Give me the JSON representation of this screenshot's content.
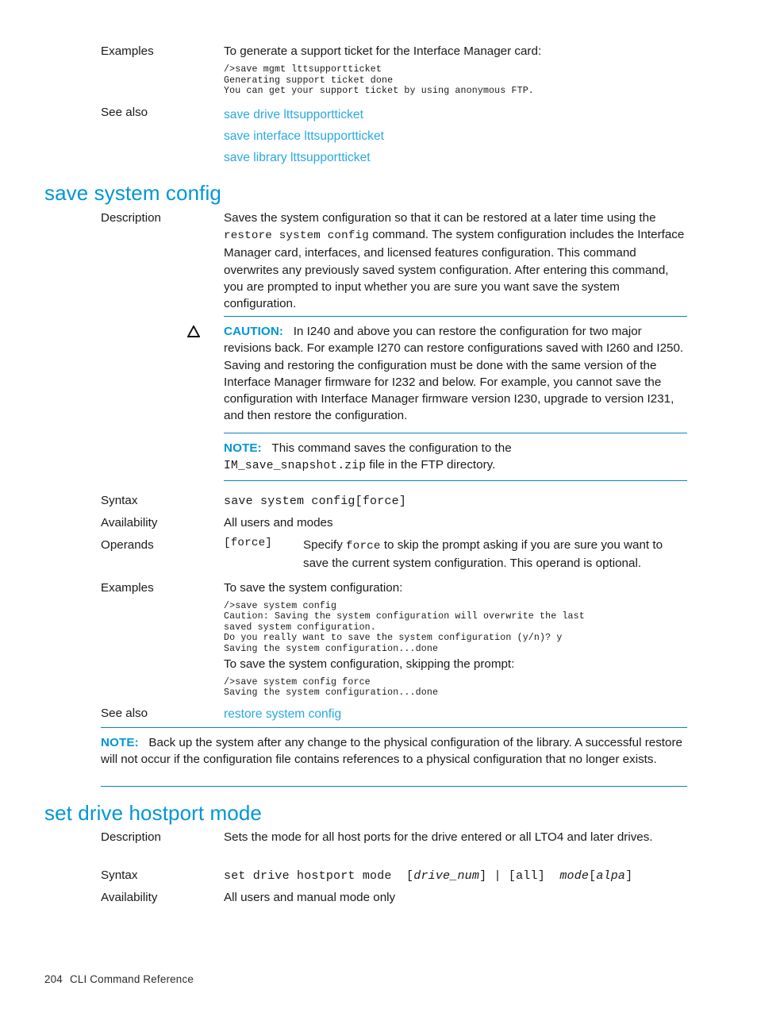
{
  "page": {
    "footer_page_number": "204",
    "footer_title": "CLI Command Reference",
    "accent_color": "#0096d6",
    "link_color": "#2aa8e0",
    "rule_color": "#0a82bd"
  },
  "top_section": {
    "examples_label": "Examples",
    "examples_intro": "To generate a support ticket for the Interface Manager card:",
    "examples_transcript": "/>save mgmt lttsupportticket\nGenerating support ticket done\nYou can get your support ticket by using anonymous FTP.",
    "see_also_label": "See also",
    "see_also_links": [
      "save drive lttsupportticket",
      "save interface lttsupportticket",
      "save library lttsupportticket"
    ]
  },
  "save_system_config": {
    "heading": "save system config",
    "description_label": "Description",
    "description_part1": "Saves the system configuration so that it can be restored at a later time using the ",
    "description_code1": "restore system config",
    "description_part2": " command. The system configuration includes the Interface Manager card, interfaces, and licensed features configuration. This command overwrites any previously saved system configuration. After entering this command, you are prompted to input whether you are sure you want save the system configuration.",
    "caution": {
      "keyword": "CAUTION:",
      "icon": "caution-triangle-icon",
      "text": "In I240 and above you can restore the configuration for two major revisions back. For example I270 can restore configurations saved with I260 and I250. Saving and restoring the configuration must be done with the same version of the Interface Manager firmware for I232 and below. For example, you cannot save the configuration with Interface Manager firmware version I230, upgrade to version I231, and then restore the configuration."
    },
    "note": {
      "keyword": "NOTE:",
      "text_part1": "This command saves the configuration to the ",
      "code": "IM_save_snapshot.zip",
      "text_part2": " file in the FTP directory."
    },
    "syntax_label": "Syntax",
    "syntax_code": "save system config",
    "syntax_operand": "[force]",
    "availability_label": "Availability",
    "availability_value": "All users and modes",
    "operands_label": "Operands",
    "operands_token": "[force]",
    "operands_text_part1": "Specify ",
    "operands_text_code": "force",
    "operands_text_part2": " to skip the prompt asking if you are sure you want to save the current system configuration. This operand is optional.",
    "examples_label": "Examples",
    "example1_intro": "To save the system configuration:",
    "example1_transcript": "/>save system config\nCaution: Saving the system configuration will overwrite the last\nsaved system configuration.\nDo you really want to save the system configuration (y/n)? y\nSaving the system configuration...done",
    "example2_intro": "To save the system configuration, skipping the prompt:",
    "example2_transcript": "/>save system config force\nSaving the system configuration...done",
    "see_also_label": "See also",
    "see_also_link": "restore system config",
    "bottom_note": {
      "keyword": "NOTE:",
      "text": "Back up the system after any change to the physical configuration of the library. A successful restore will not occur if the configuration file contains references to a physical configuration that no longer exists."
    }
  },
  "set_drive_hostport_mode": {
    "heading": "set drive hostport mode",
    "description_label": "Description",
    "description_value": "Sets the mode for all host ports for the drive entered or all LTO4 and later drives.",
    "syntax_label": "Syntax",
    "syntax_tokens": [
      {
        "text": "set drive hostport mode",
        "style": "mono"
      },
      {
        "text": "  ",
        "style": "mono"
      },
      {
        "text": "[",
        "style": "mono"
      },
      {
        "text": "drive_num",
        "style": "mono-i"
      },
      {
        "text": "]",
        "style": "mono"
      },
      {
        "text": " | ",
        "style": "mono"
      },
      {
        "text": "[all]",
        "style": "mono"
      },
      {
        "text": "  ",
        "style": "mono"
      },
      {
        "text": "mode",
        "style": "mono-i"
      },
      {
        "text": "[",
        "style": "mono"
      },
      {
        "text": "alpa",
        "style": "mono-i"
      },
      {
        "text": "]",
        "style": "mono"
      }
    ],
    "availability_label": "Availability",
    "availability_value": "All users and manual mode only"
  }
}
